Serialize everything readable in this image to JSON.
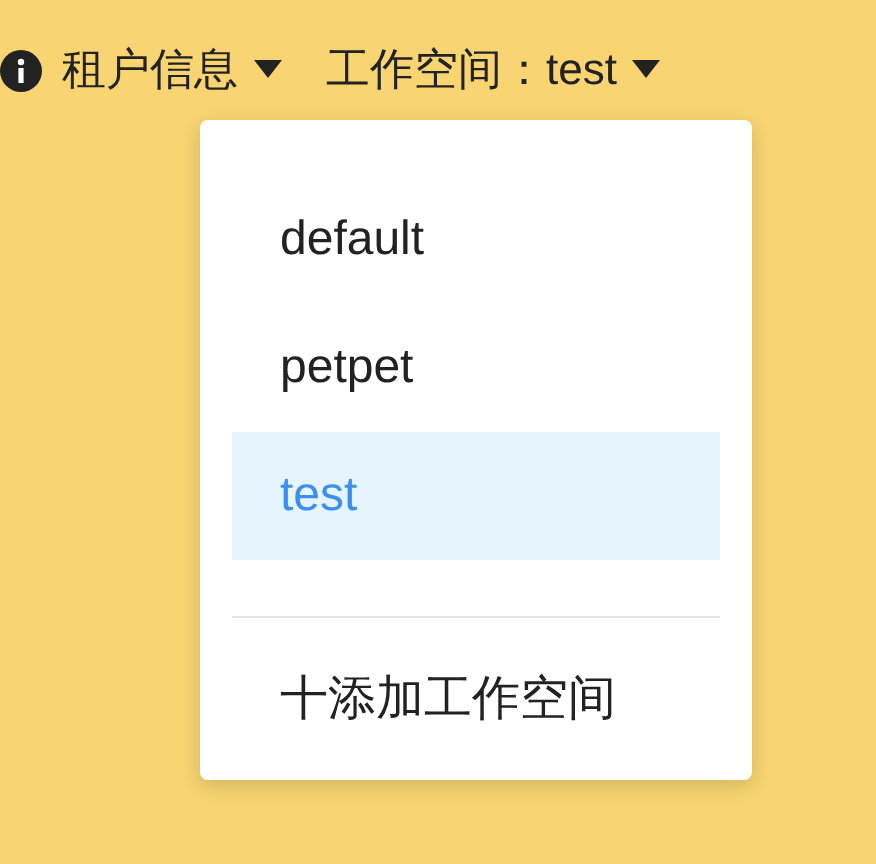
{
  "header": {
    "tenant_menu": {
      "label": "租户信息"
    },
    "workspace_menu": {
      "label": "工作空间：test"
    }
  },
  "dropdown": {
    "items": [
      {
        "label": "default",
        "selected": false
      },
      {
        "label": "petpet",
        "selected": false
      },
      {
        "label": "test",
        "selected": true
      }
    ],
    "add_action": {
      "label": "十添加工作空间"
    }
  }
}
